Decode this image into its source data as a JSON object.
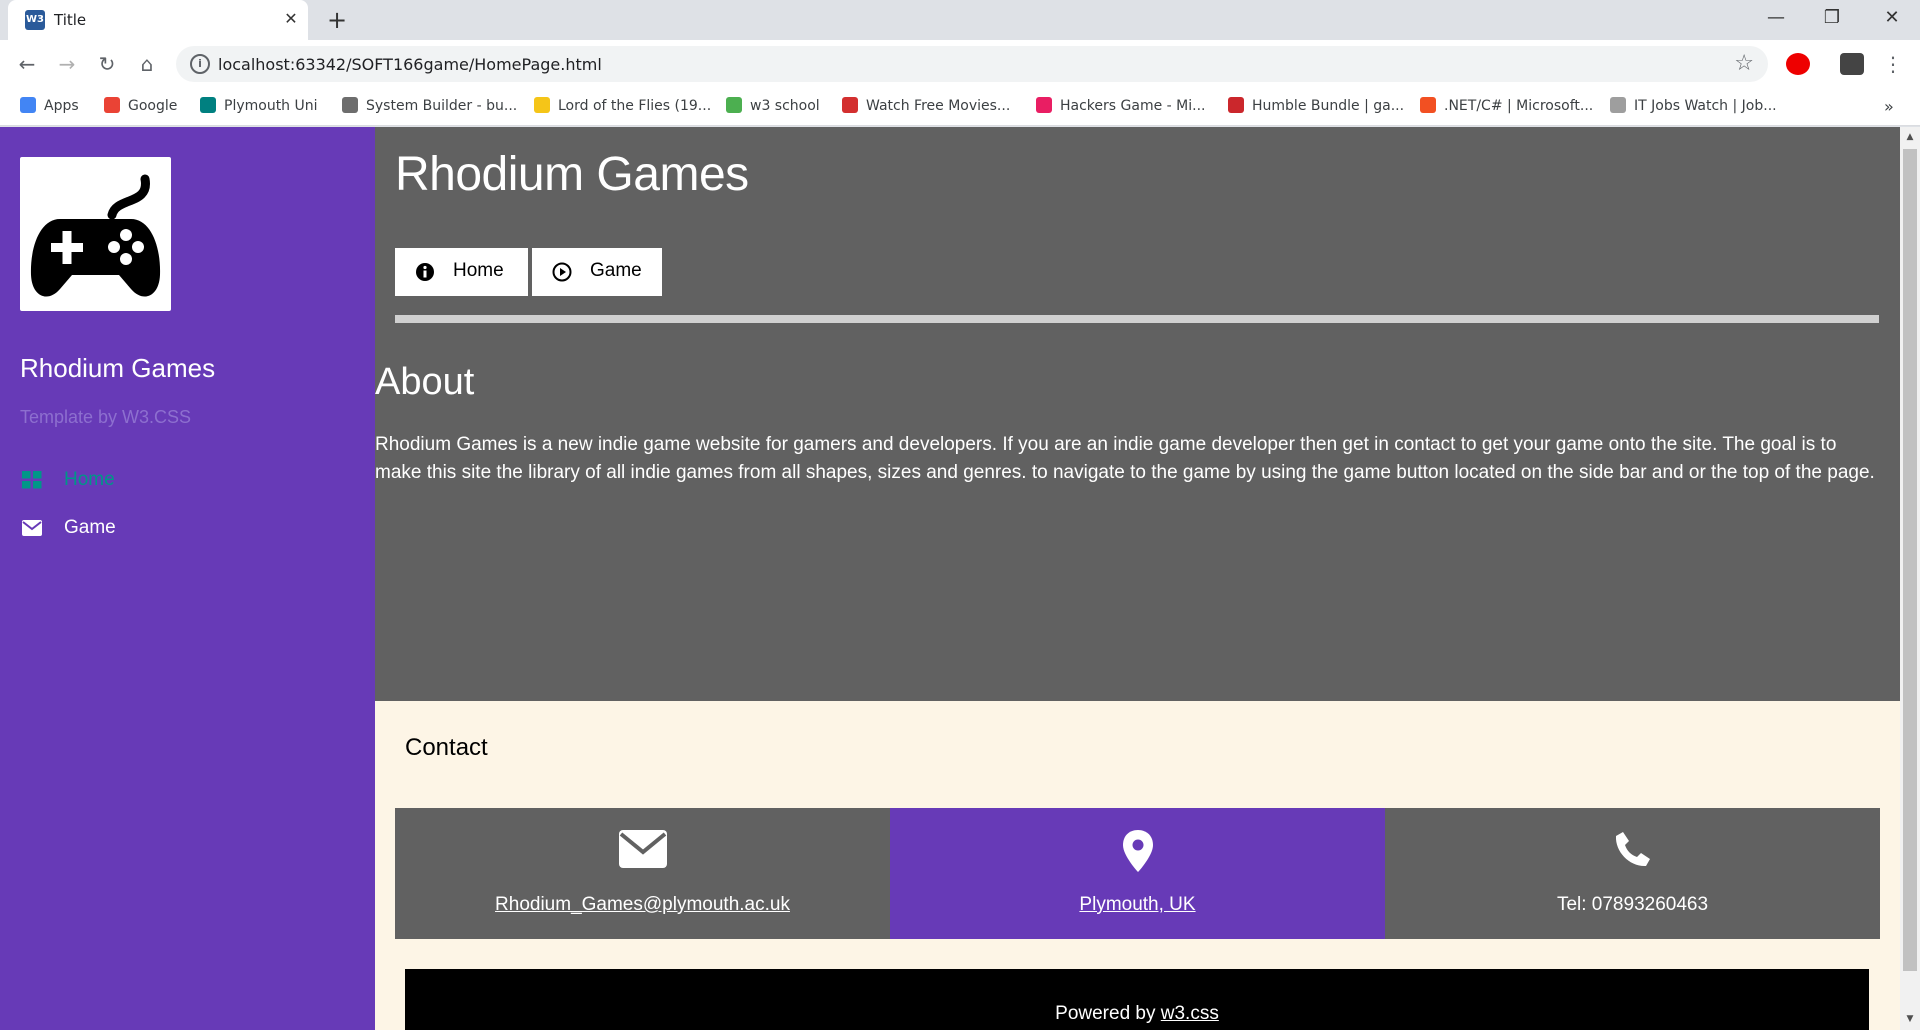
{
  "browser": {
    "tab_title": "Title",
    "tab_favicon": "W3",
    "url": "localhost:63342/SOFT166game/HomePage.html",
    "bookmarks": [
      {
        "label": "Apps",
        "icon": "apps-grid-icon",
        "color": "#4285f4"
      },
      {
        "label": "Google",
        "icon": "google-icon",
        "color": "#ea4335"
      },
      {
        "label": "Plymouth Uni",
        "icon": "plymouth-uni-icon",
        "color": "#008080"
      },
      {
        "label": "System Builder - bu...",
        "icon": "system-builder-icon",
        "color": "#6d6d6d"
      },
      {
        "label": "Lord of the Flies (19...",
        "icon": "imdb-icon",
        "color": "#f5c518"
      },
      {
        "label": "w3 school",
        "icon": "w3-icon",
        "color": "#4caf50"
      },
      {
        "label": "Watch Free Movies...",
        "icon": "vimeo-v-icon",
        "color": "#d32f2f"
      },
      {
        "label": "Hackers Game - Mi...",
        "icon": "hackers-game-icon",
        "color": "#e91e63"
      },
      {
        "label": "Humble Bundle | ga...",
        "icon": "humble-h-icon",
        "color": "#cb272c"
      },
      {
        "label": ".NET/C# | Microsoft...",
        "icon": "microsoft-icon",
        "color": "#f25022"
      },
      {
        "label": "IT Jobs Watch | Job...",
        "icon": "cloud-icon",
        "color": "#9e9e9e"
      }
    ]
  },
  "sidebar": {
    "title": "Rhodium Games",
    "subtitle": "Template by W3.CSS",
    "items": [
      {
        "label": "Home",
        "icon": "grid-icon",
        "color": "#009688"
      },
      {
        "label": "Game",
        "icon": "envelope-icon",
        "color": "#ffffff"
      }
    ]
  },
  "main": {
    "title": "Rhodium Games",
    "buttons": [
      {
        "label": "Home",
        "icon": "info-circle-icon"
      },
      {
        "label": "Game",
        "icon": "play-circle-icon"
      }
    ],
    "about_heading": "About",
    "about_text": "Rhodium Games is a new indie game website for gamers and developers. If you are an indie game developer then get in contact to get your game onto the site. The goal is to make this site the library of all indie games from all shapes, sizes and genres. to navigate to the game by using the game button located on the side bar and or the top of the page."
  },
  "contact": {
    "heading": "Contact",
    "cards": [
      {
        "text": "Rhodium_Games@plymouth.ac.uk",
        "icon": "envelope-icon",
        "color": "#616161"
      },
      {
        "text": "Plymouth, UK",
        "icon": "map-marker-icon",
        "color": "#673ab7"
      },
      {
        "text": "Tel: 07893260463",
        "icon": "phone-icon",
        "color": "#616161"
      }
    ]
  },
  "footer": {
    "prefix": "Powered by ",
    "link": "w3.css"
  },
  "colors": {
    "sidebar": "#673ab7",
    "main_bg": "#616161",
    "contact_bg": "#fdf5e6"
  }
}
